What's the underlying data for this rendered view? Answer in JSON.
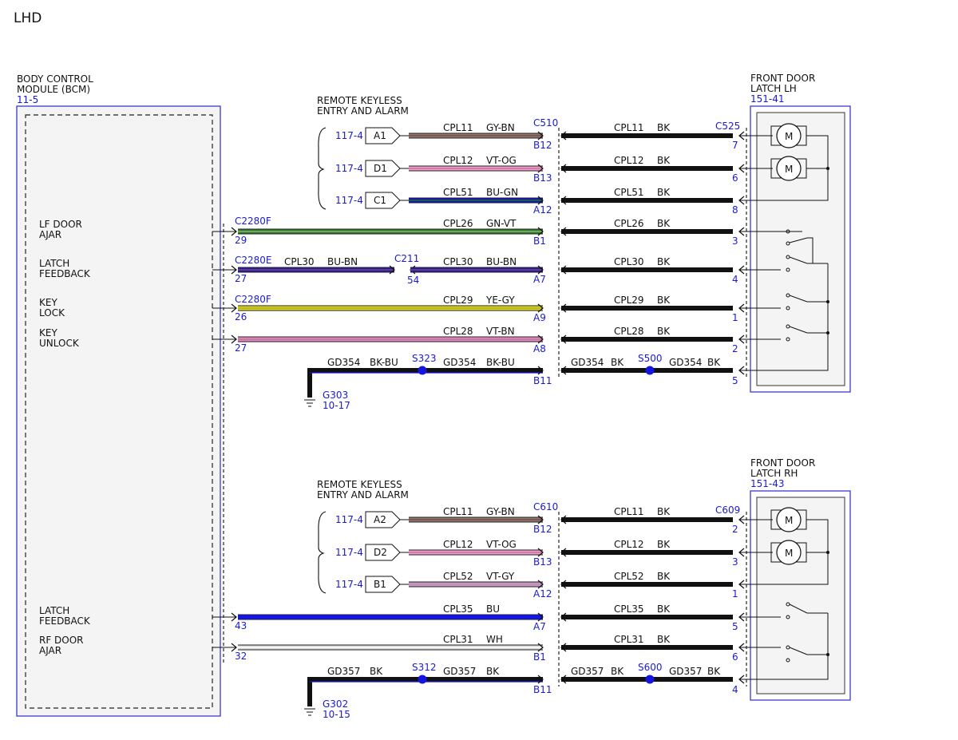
{
  "page": {
    "title": "LHD"
  },
  "colors": {
    "label_blue": "#1a1ad6",
    "module_border": "#3a3ad0",
    "module_fill": "#f4f4f4",
    "wire_black": "#111111",
    "splice_blue": "#1515e0",
    "GY-BN": [
      "#8b7a78",
      "#7a4a3a"
    ],
    "VT-OG": [
      "#f3a0c8",
      "#c86fa8"
    ],
    "BU-GN": [
      "#1414c0",
      "#1e6e28"
    ],
    "GN-VT": [
      "#2e7d2e",
      "#8ab46a"
    ],
    "BU-BN": [
      "#1a1ac8",
      "#8c4a2a"
    ],
    "YE-GY": [
      "#e8e000",
      "#a0a060"
    ],
    "VT-BN": [
      "#eb88c0",
      "#b07898"
    ],
    "VT-GY": [
      "#d890d0",
      "#a0a0a8"
    ],
    "BU": [
      "#1414ee",
      "#1414ee"
    ],
    "WH": [
      "#d8d8d8",
      "#ffffff"
    ]
  },
  "modules": {
    "bcm": {
      "name": [
        "BODY CONTROL",
        "MODULE (BCM)"
      ],
      "ref": "11-5"
    },
    "latch_lh": {
      "name": [
        "FRONT DOOR",
        "LATCH LH"
      ],
      "ref": "151-41"
    },
    "latch_rh": {
      "name": [
        "FRONT DOOR",
        "LATCH RH"
      ],
      "ref": "151-43"
    }
  },
  "rke_groups": [
    {
      "label": [
        "REMOTE KEYLESS",
        "ENTRY AND ALARM"
      ]
    },
    {
      "label": [
        "REMOTE KEYLESS",
        "ENTRY AND ALARM"
      ]
    }
  ],
  "bcm_pins": [
    {
      "label": [
        "LF DOOR",
        "AJAR"
      ]
    },
    {
      "label": [
        "LATCH",
        "FEEDBACK"
      ]
    },
    {
      "label": [
        "KEY",
        "LOCK"
      ]
    },
    {
      "label": [
        "KEY",
        "UNLOCK"
      ]
    },
    {
      "label": [
        "LATCH",
        "FEEDBACK"
      ]
    },
    {
      "label": [
        "RF DOOR",
        "AJAR"
      ]
    }
  ],
  "connectors": {
    "left_top": "C510",
    "right_top": "C525",
    "left_bottom": "C610",
    "right_bottom": "C609",
    "c2280f_a": "C2280F",
    "c2280e": "C2280E",
    "c211": "C211",
    "c2280f_b": "C2280F"
  },
  "wires": [
    {
      "ref": "117-4",
      "pin": "A1",
      "cpl": "CPL11",
      "color": "GY-BN",
      "lpin": "B12",
      "rcpl": "CPL11",
      "rcolor": "BK",
      "rpin": "7"
    },
    {
      "ref": "117-4",
      "pin": "D1",
      "cpl": "CPL12",
      "color": "VT-OG",
      "lpin": "B13",
      "rcpl": "CPL12",
      "rcolor": "BK",
      "rpin": "6"
    },
    {
      "ref": "117-4",
      "pin": "C1",
      "cpl": "CPL51",
      "color": "BU-GN",
      "lpin": "A12",
      "rcpl": "CPL51",
      "rcolor": "BK",
      "rpin": "8"
    },
    {
      "bcmpin": "29",
      "cpl": "CPL26",
      "color": "GN-VT",
      "lpin": "B1",
      "rcpl": "CPL26",
      "rcolor": "BK",
      "rpin": "3"
    },
    {
      "bcmpin": "27",
      "cpl0": "CPL30",
      "color0": "BU-BN",
      "midpin": "54",
      "cpl": "CPL30",
      "color": "BU-BN",
      "lpin": "A7",
      "rcpl": "CPL30",
      "rcolor": "BK",
      "rpin": "4"
    },
    {
      "bcmpin": "26",
      "cpl": "CPL29",
      "color": "YE-GY",
      "lpin": "A9",
      "rcpl": "CPL29",
      "rcolor": "BK",
      "rpin": "1"
    },
    {
      "bcmpin": "27",
      "cpl": "CPL28",
      "color": "VT-BN",
      "lpin": "A8",
      "rcpl": "CPL28",
      "rcolor": "BK",
      "rpin": "2"
    },
    {
      "ref": "117-4",
      "pin": "A2",
      "cpl": "CPL11",
      "color": "GY-BN",
      "lpin": "B12",
      "rcpl": "CPL11",
      "rcolor": "BK",
      "rpin": "2"
    },
    {
      "ref": "117-4",
      "pin": "D2",
      "cpl": "CPL12",
      "color": "VT-OG",
      "lpin": "B13",
      "rcpl": "CPL12",
      "rcolor": "BK",
      "rpin": "3"
    },
    {
      "ref": "117-4",
      "pin": "B1",
      "cpl": "CPL52",
      "color": "VT-GY",
      "lpin": "A12",
      "rcpl": "CPL52",
      "rcolor": "BK",
      "rpin": "1"
    },
    {
      "bcmpin": "43",
      "cpl": "CPL35",
      "color": "BU",
      "lpin": "A7",
      "rcpl": "CPL35",
      "rcolor": "BK",
      "rpin": "5"
    },
    {
      "bcmpin": "32",
      "cpl": "CPL31",
      "color": "WH",
      "lpin": "B1",
      "rcpl": "CPL31",
      "rcolor": "BK",
      "rpin": "6"
    }
  ],
  "grounds": [
    {
      "c1": "GD354",
      "col1": "BK-BU",
      "splice": "S323",
      "c2": "GD354",
      "col2": "BK-BU",
      "lpin": "B11",
      "c3": "GD354",
      "col3": "BK",
      "splice2": "S500",
      "c4": "GD354",
      "col4": "BK",
      "rpin": "5",
      "ground": "G303",
      "gref": "10-17"
    },
    {
      "c1": "GD357",
      "col1": "BK",
      "splice": "S312",
      "c2": "GD357",
      "col2": "BK",
      "lpin": "B11",
      "c3": "GD357",
      "col3": "BK",
      "splice2": "S600",
      "c4": "GD357",
      "col4": "BK",
      "rpin": "4",
      "ground": "G302",
      "gref": "10-15"
    }
  ]
}
